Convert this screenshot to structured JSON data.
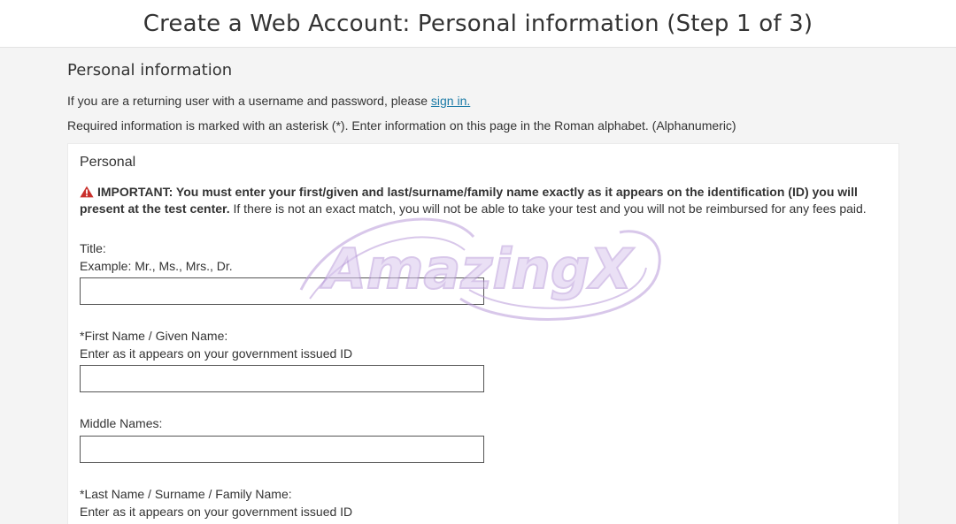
{
  "header": {
    "title": "Create a Web Account: Personal information (Step 1 of 3)"
  },
  "main": {
    "section_title": "Personal information",
    "returning_text": "If you are a returning user with a username and password, please",
    "sign_in_link": "sign in.",
    "required_text": "Required information is marked with an asterisk (*). Enter information on this page in the Roman alphabet. (Alphanumeric)"
  },
  "card": {
    "title": "Personal",
    "important_bold": "IMPORTANT: You must enter your first/given and last/surname/family name exactly as it appears on the identification (ID) you will present at the test center.",
    "important_rest": " If there is not an exact match, you will not be able to take your test and you will not be reimbursed for any fees paid.",
    "fields": {
      "title": {
        "label": "Title:",
        "hint": "Example: Mr., Ms., Mrs., Dr.",
        "value": ""
      },
      "first_name": {
        "label": "*First Name / Given Name:",
        "hint": "Enter as it appears on your government issued ID",
        "value": ""
      },
      "middle_names": {
        "label": "Middle Names:",
        "value": ""
      },
      "last_name": {
        "label": "*Last Name / Surname / Family Name:",
        "hint": "Enter as it appears on your government issued ID"
      }
    }
  },
  "watermark": {
    "text": "AmazingX"
  },
  "colors": {
    "link": "#1a7aa6",
    "warning_icon": "#c9302c",
    "watermark": "#b99bd9"
  },
  "icons": {
    "warning": "warning-triangle-icon"
  }
}
